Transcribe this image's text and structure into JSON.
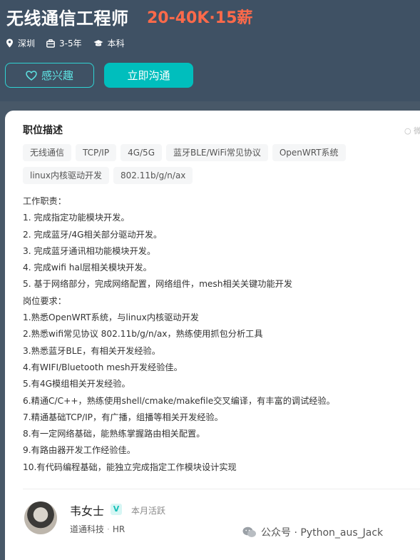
{
  "header": {
    "title": "无线通信工程师",
    "salary": "20-40K·15薪",
    "location": "深圳",
    "experience": "3-5年",
    "education": "本科",
    "interest_button": "感兴趣",
    "chat_button": "立即沟通"
  },
  "description": {
    "section_title": "职位描述",
    "side_text": "微",
    "tags": [
      "无线通信",
      "TCP/IP",
      "4G/5G",
      "蓝牙BLE/WiFi常见协议",
      "OpenWRT系统",
      "linux内核驱动开发",
      "802.11b/g/n/ax"
    ],
    "lines": [
      "工作职责：",
      "1. 完成指定功能模块开发。",
      "2.  完成蓝牙/4G相关部分驱动开发。",
      "3. 完成蓝牙通讯相功能模块开发。",
      "4.  完成wifi hal层相关模块开发。",
      "5.  基于网络部分，完成网络配置，网络组件，mesh相关关键功能开发",
      "岗位要求：",
      "1.熟悉OpenWRT系统，与linux内核驱动开发",
      "2.熟悉wifi常见协议 802.11b/g/n/ax，熟练使用抓包分析工具",
      "3.熟悉蓝牙BLE，有相关开发经验。",
      "4.有WIFI/Bluetooth mesh开发经验佳。",
      "5.有4G模组相关开发经验。",
      "6.精通C/C++，熟练使用shell/cmake/makefile交叉编译，有丰富的调试经验。",
      "7.精通基础TCP/IP，有广播，组播等相关开发经验。",
      "8.有一定网络基础，能熟练掌握路由相关配置。",
      "9.有路由器开发工作经验佳。",
      "10.有代码编程基础，能独立完成指定工作模块设计实现"
    ]
  },
  "recruiter": {
    "name": "韦女士",
    "verify_badge": "V",
    "active_status": "本月活跃",
    "company": "道通科技",
    "separator": "·",
    "role": "HR"
  },
  "watermark": {
    "text": "公众号 · Python_aus_Jack"
  },
  "colors": {
    "header_bg": "#3f5164",
    "salary": "#ff6a4a",
    "accent": "#00bebd"
  }
}
